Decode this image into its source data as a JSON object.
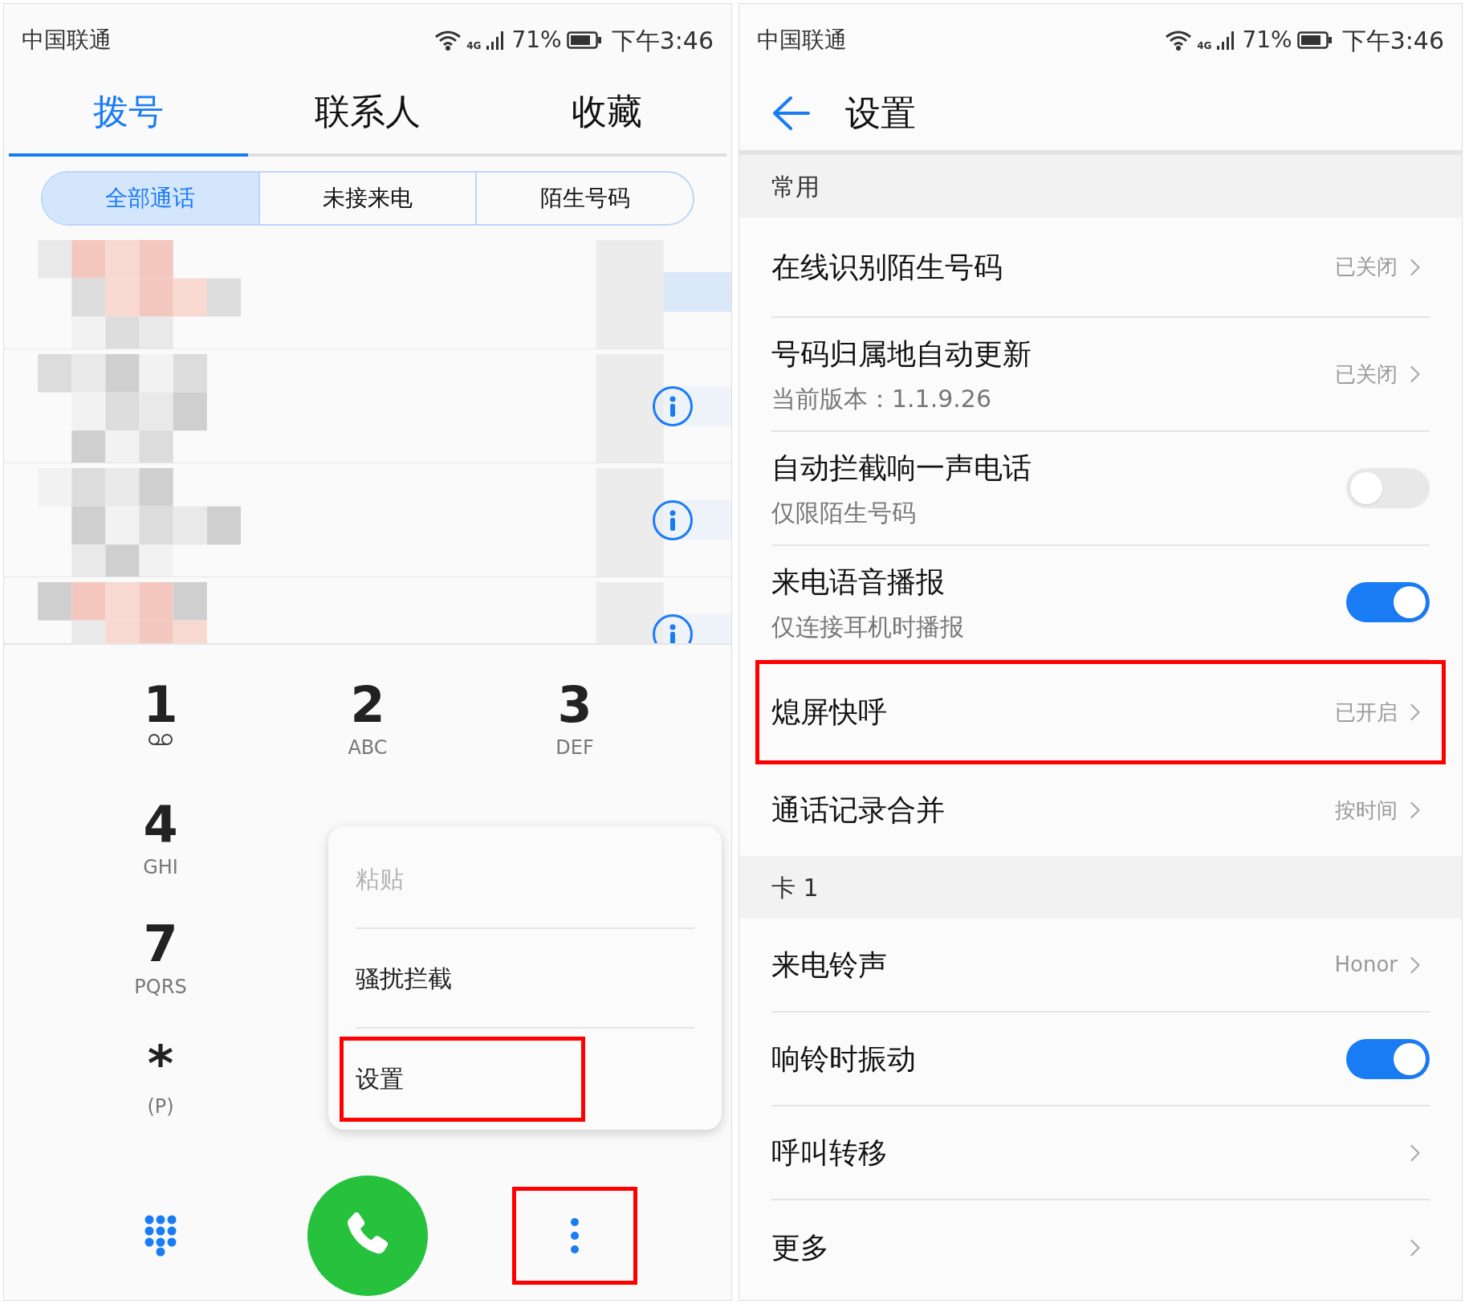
{
  "left": {
    "status_bar": {
      "carrier": "中国联通",
      "network": "4G",
      "battery": "71%",
      "time": "下午3:46"
    },
    "tabs": [
      {
        "label": "拨号",
        "selected": true
      },
      {
        "label": "联系人",
        "selected": false
      },
      {
        "label": "收藏",
        "selected": false
      }
    ],
    "filters": [
      {
        "label": "全部通话",
        "selected": true
      },
      {
        "label": "未接来电",
        "selected": false
      },
      {
        "label": "陌生号码",
        "selected": false
      }
    ],
    "call_log": [
      {
        "kind": "picture",
        "info_button": false
      },
      {
        "kind": "picture",
        "info_button": true
      },
      {
        "kind": "picture",
        "info_button": true
      },
      {
        "kind": "picture",
        "info_button": true
      }
    ],
    "keypad": [
      [
        {
          "digit": "1",
          "kind": "voicemail"
        },
        {
          "digit": "2",
          "kind": "letters",
          "letters": "ABC"
        },
        {
          "digit": "3",
          "kind": "letters",
          "letters": "DEF"
        }
      ],
      [
        {
          "digit": "4",
          "kind": "letters",
          "letters": "GHI"
        }
      ],
      [
        {
          "digit": "7",
          "kind": "letters",
          "letters": "PQRS"
        }
      ],
      [
        {
          "digit": "*",
          "kind": "letters",
          "letters": "(P)"
        }
      ]
    ],
    "menu": [
      {
        "label": "粘贴",
        "disabled": true,
        "highlighted": false
      },
      {
        "label": "骚扰拦截",
        "disabled": false,
        "highlighted": false
      },
      {
        "label": "设置",
        "disabled": false,
        "highlighted": true
      }
    ],
    "more_button": {
      "highlighted": true
    }
  },
  "right": {
    "status_bar": {
      "carrier": "中国联通",
      "network": "4G",
      "battery": "71%",
      "time": "下午3:46"
    },
    "title": "设置",
    "sections": [
      {
        "title": "常用",
        "rows": [
          {
            "kind": "value",
            "title": "在线识别陌生号码",
            "value": "已关闭",
            "highlighted": false
          },
          {
            "kind": "value",
            "title": "号码归属地自动更新",
            "subtitle": "当前版本：1.1.9.26",
            "value": "已关闭",
            "highlighted": false
          },
          {
            "kind": "toggle",
            "title": "自动拦截响一声电话",
            "subtitle": "仅限陌生号码",
            "on": false,
            "highlighted": false
          },
          {
            "kind": "toggle",
            "title": "来电语音播报",
            "subtitle": "仅连接耳机时播报",
            "on": true,
            "highlighted": false
          },
          {
            "kind": "value",
            "title": "熄屏快呼",
            "value": "已开启",
            "highlighted": true
          },
          {
            "kind": "value",
            "title": "通话记录合并",
            "value": "按时间",
            "highlighted": false
          }
        ]
      },
      {
        "title": "卡 1",
        "rows": [
          {
            "kind": "value",
            "title": "来电铃声",
            "value": "Honor",
            "highlighted": false
          },
          {
            "kind": "toggle",
            "title": "响铃时振动",
            "on": true,
            "highlighted": false
          },
          {
            "kind": "link",
            "title": "呼叫转移",
            "highlighted": false
          },
          {
            "kind": "link",
            "title": "更多",
            "highlighted": false
          }
        ]
      }
    ]
  }
}
